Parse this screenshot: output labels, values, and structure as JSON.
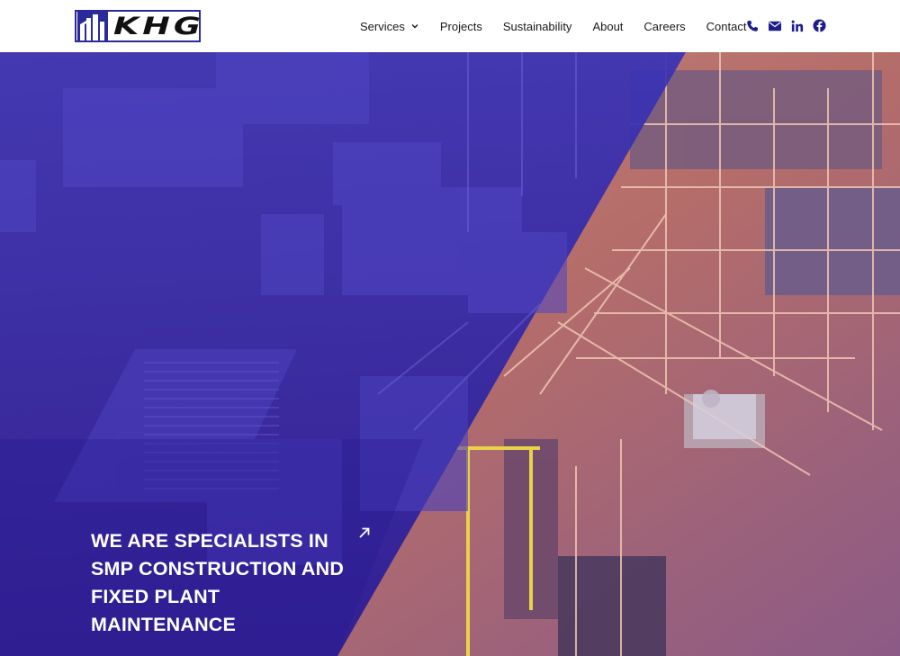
{
  "brand": {
    "logo_text": "KHG",
    "color": "#2b2a9a"
  },
  "nav": {
    "items": [
      {
        "label": "Services",
        "has_dropdown": true
      },
      {
        "label": "Projects"
      },
      {
        "label": "Sustainability"
      },
      {
        "label": "About"
      },
      {
        "label": "Careers"
      },
      {
        "label": "Contact"
      }
    ]
  },
  "social": {
    "icons": [
      "phone-icon",
      "email-icon",
      "linkedin-icon",
      "facebook-icon"
    ],
    "color": "#1f1d8c"
  },
  "hero": {
    "headline_lines": [
      "WE ARE SPECIALISTS IN",
      "SMP CONSTRUCTION AND",
      "FIXED PLANT",
      "MAINTENANCE"
    ],
    "arrow_icon": "arrow-up-right-icon",
    "overlay_color": "#2a1fa0"
  }
}
